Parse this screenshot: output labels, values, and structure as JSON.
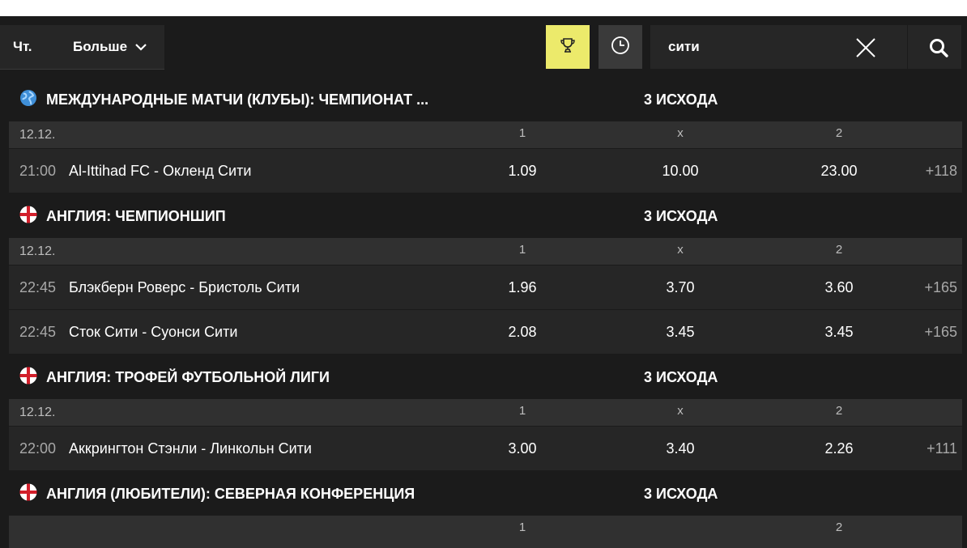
{
  "toolbar": {
    "day_tab": "Чт.",
    "more_label": "Больше",
    "search_value": "сити"
  },
  "columns": {
    "c1": "1",
    "cx": "x",
    "c2": "2"
  },
  "leagues": [
    {
      "name": "МЕЖДУНАРОДНЫЕ МАТЧИ (КЛУБЫ): ЧЕМПИОНАТ ...",
      "market": "3 ИСХОДА",
      "flag": "globe-icon",
      "date": "12.12.",
      "matches": [
        {
          "time": "21:00",
          "teams": "Al-Ittihad FC - Окленд Сити",
          "o1": "1.09",
          "ox": "10.00",
          "o2": "23.00",
          "more": "+118"
        }
      ]
    },
    {
      "name": "АНГЛИЯ: ЧЕМПИОНШИП",
      "market": "3 ИСХОДА",
      "flag": "england-flag-icon",
      "date": "12.12.",
      "matches": [
        {
          "time": "22:45",
          "teams": "Блэкберн Роверс - Бристоль Сити",
          "o1": "1.96",
          "ox": "3.70",
          "o2": "3.60",
          "more": "+165"
        },
        {
          "time": "22:45",
          "teams": "Сток Сити - Суонси Сити",
          "o1": "2.08",
          "ox": "3.45",
          "o2": "3.45",
          "more": "+165"
        }
      ]
    },
    {
      "name": "АНГЛИЯ: ТРОФЕЙ ФУТБОЛЬНОЙ ЛИГИ",
      "market": "3 ИСХОДА",
      "flag": "england-flag-icon",
      "date": "12.12.",
      "matches": [
        {
          "time": "22:00",
          "teams": "Аккрингтон Стэнли - Линкольн Сити",
          "o1": "3.00",
          "ox": "3.40",
          "o2": "2.26",
          "more": "+111"
        }
      ]
    },
    {
      "name": "АНГЛИЯ (ЛЮБИТЕЛИ): СЕВЕРНАЯ КОНФЕРЕНЦИЯ",
      "market": "3 ИСХОДА",
      "flag": "england-flag-icon"
    }
  ],
  "colors": {
    "accent": "#ecea6b",
    "background": "#1b1b1b",
    "row": "#262626",
    "header": "#303030"
  }
}
